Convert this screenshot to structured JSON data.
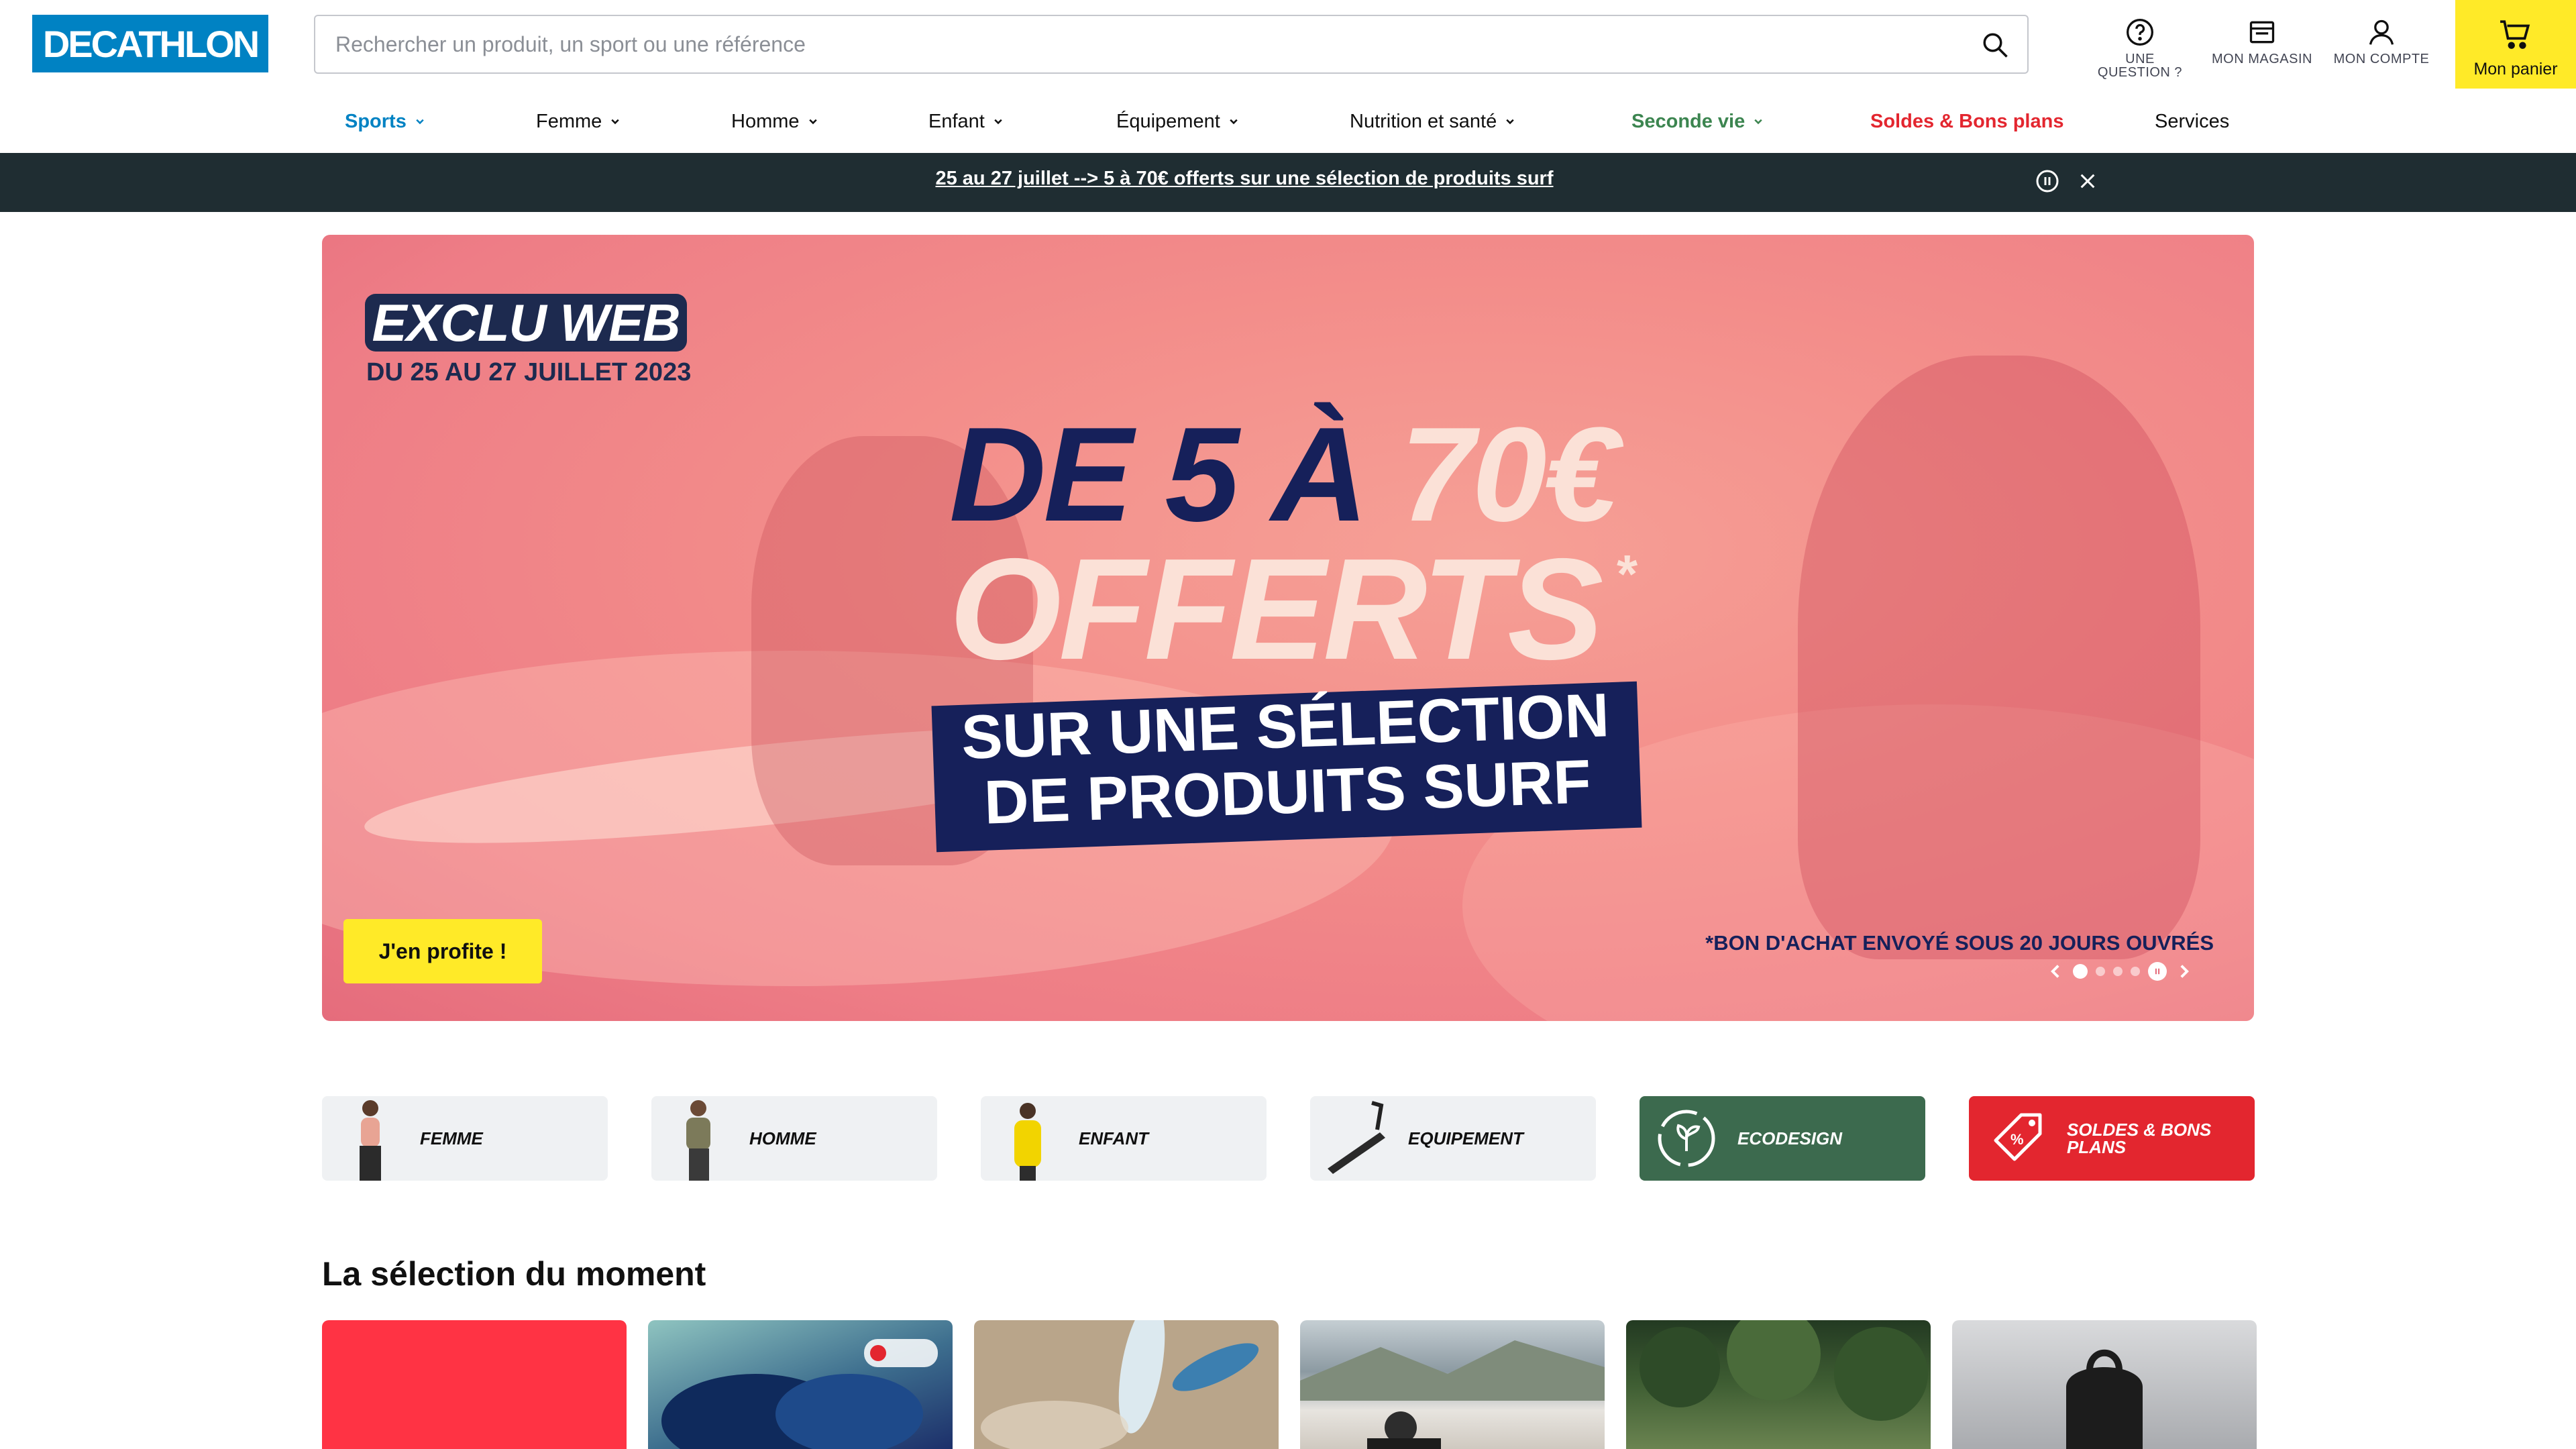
{
  "header": {
    "logo_text": "DECATHLON",
    "search_placeholder": "Rechercher un produit, un sport ou une référence",
    "question_label": "UNE QUESTION ?",
    "store_label": "MON MAGASIN",
    "account_label": "MON COMPTE",
    "cart_label": "Mon panier"
  },
  "nav": {
    "items": [
      {
        "label": "Sports"
      },
      {
        "label": "Femme"
      },
      {
        "label": "Homme"
      },
      {
        "label": "Enfant"
      },
      {
        "label": "Équipement"
      },
      {
        "label": "Nutrition et santé"
      },
      {
        "label": "Seconde vie"
      },
      {
        "label": "Soldes & Bons plans"
      },
      {
        "label": "Services"
      }
    ]
  },
  "promo_bar": {
    "text": "25 au 27 juillet --> 5 à 70€ offerts sur une sélection de produits surf"
  },
  "hero": {
    "badge": "EXCLU WEB",
    "dates": "DU 25 AU 27 JUILLET 2023",
    "line1_navy": "DE 5 À ",
    "line1_cream": "70€",
    "line2": "OFFERTS",
    "star": "*",
    "ribbon_line1": "SUR UNE SÉLECTION",
    "ribbon_line2": "DE PRODUITS SURF",
    "cta": "J'en profite !",
    "footnote": "*BON D'ACHAT ENVOYÉ SOUS 20 JOURS OUVRÉS",
    "slides_total": 4,
    "active_slide": 1
  },
  "categories": [
    {
      "label": "FEMME"
    },
    {
      "label": "HOMME"
    },
    {
      "label": "ENFANT"
    },
    {
      "label": "EQUIPEMENT"
    },
    {
      "label": "ECODESIGN"
    },
    {
      "label": "SOLDES & BONS PLANS"
    }
  ],
  "selection": {
    "title": "La sélection du moment"
  },
  "colors": {
    "brand_blue": "#0082c3",
    "cart_yellow": "#ffea28",
    "promo_bar_bg": "#1f2d32",
    "eco_green": "#3c6a4e",
    "soldes_red": "#e3262f"
  }
}
